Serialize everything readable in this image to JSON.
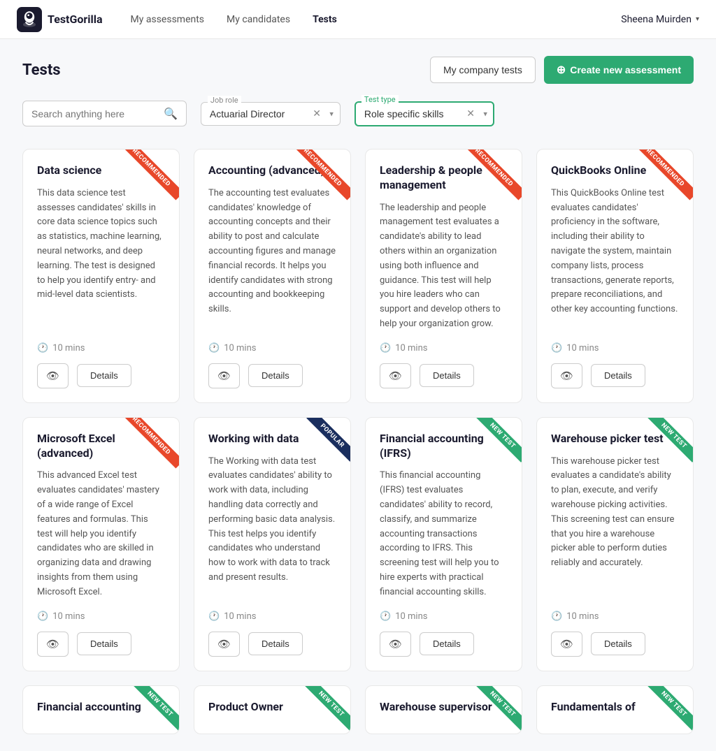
{
  "nav": {
    "logo_text": "TestGorilla",
    "links": [
      {
        "label": "My assessments",
        "active": false
      },
      {
        "label": "My candidates",
        "active": false
      },
      {
        "label": "Tests",
        "active": true
      }
    ],
    "user": "Sheena Muirden"
  },
  "page": {
    "title": "Tests",
    "btn_company": "My company tests",
    "btn_create_plus": "+",
    "btn_create": "Create new assessment"
  },
  "filters": {
    "search_placeholder": "Search anything here",
    "job_role_label": "Job role",
    "job_role_value": "Actuarial Director",
    "test_type_label": "Test type",
    "test_type_value": "Role specific skills"
  },
  "cards": [
    {
      "title": "Data science",
      "ribbon": "RECOMMENDED",
      "ribbon_type": "recommended",
      "desc": "This data science test assesses candidates' skills in core data science topics such as statistics, machine learning, neural networks, and deep learning. The test is designed to help you identify entry- and mid-level data scientists.",
      "time": "10 mins",
      "btn_details": "Details"
    },
    {
      "title": "Accounting (advanced)",
      "ribbon": "RECOMMENDED",
      "ribbon_type": "recommended",
      "desc": "The accounting test evaluates candidates' knowledge of accounting concepts and their ability to post and calculate accounting figures and manage financial records. It helps you identify candidates with strong accounting and bookkeeping skills.",
      "time": "10 mins",
      "btn_details": "Details"
    },
    {
      "title": "Leadership & people management",
      "ribbon": "RECOMMENDED",
      "ribbon_type": "recommended",
      "desc": "The leadership and people management test evaluates a candidate's ability to lead others within an organization using both influence and guidance. This test will help you hire leaders who can support and develop others to help your organization grow.",
      "time": "10 mins",
      "btn_details": "Details"
    },
    {
      "title": "QuickBooks Online",
      "ribbon": "RECOMMENDED",
      "ribbon_type": "recommended",
      "desc": "This QuickBooks Online test evaluates candidates' proficiency in the software, including their ability to navigate the system, maintain company lists, process transactions, generate reports, prepare reconciliations, and other key accounting functions.",
      "time": "10 mins",
      "btn_details": "Details"
    },
    {
      "title": "Microsoft Excel (advanced)",
      "ribbon": "RECOMMENDED",
      "ribbon_type": "recommended",
      "desc": "This advanced Excel test evaluates candidates' mastery of a wide range of Excel features and formulas. This test will help you identify candidates who are skilled in organizing data and drawing insights from them using Microsoft Excel.",
      "time": "10 mins",
      "btn_details": "Details"
    },
    {
      "title": "Working with data",
      "ribbon": "POPULAR",
      "ribbon_type": "popular",
      "desc": "The Working with data test evaluates candidates' ability to work with data, including handling data correctly and performing basic data analysis. This test helps you identify candidates who understand how to work with data to track and present results.",
      "time": "10 mins",
      "btn_details": "Details"
    },
    {
      "title": "Financial accounting (IFRS)",
      "ribbon": "NEW TEST",
      "ribbon_type": "new-test",
      "desc": "This financial accounting (IFRS) test evaluates candidates' ability to record, classify, and summarize accounting transactions according to IFRS. This screening test will help you to hire experts with practical financial accounting skills.",
      "time": "10 mins",
      "btn_details": "Details"
    },
    {
      "title": "Warehouse picker test",
      "ribbon": "NEW TEST",
      "ribbon_type": "new-test",
      "desc": "This warehouse picker test evaluates a candidate's ability to plan, execute, and verify warehouse picking activities. This screening test can ensure that you hire a warehouse picker able to perform duties reliably and accurately.",
      "time": "10 mins",
      "btn_details": "Details"
    }
  ],
  "partial_cards": [
    {
      "title": "Financial accounting",
      "ribbon_type": "new-test"
    },
    {
      "title": "Product Owner",
      "ribbon_type": "new-test"
    },
    {
      "title": "Warehouse supervisor",
      "ribbon_type": "new-test"
    },
    {
      "title": "Fundamentals of",
      "ribbon_type": "new-test"
    }
  ],
  "icons": {
    "clock": "🕐",
    "eye": "👁",
    "search": "🔍",
    "chevron_down": "▾",
    "close": "✕",
    "plus_circle": "⊕"
  }
}
